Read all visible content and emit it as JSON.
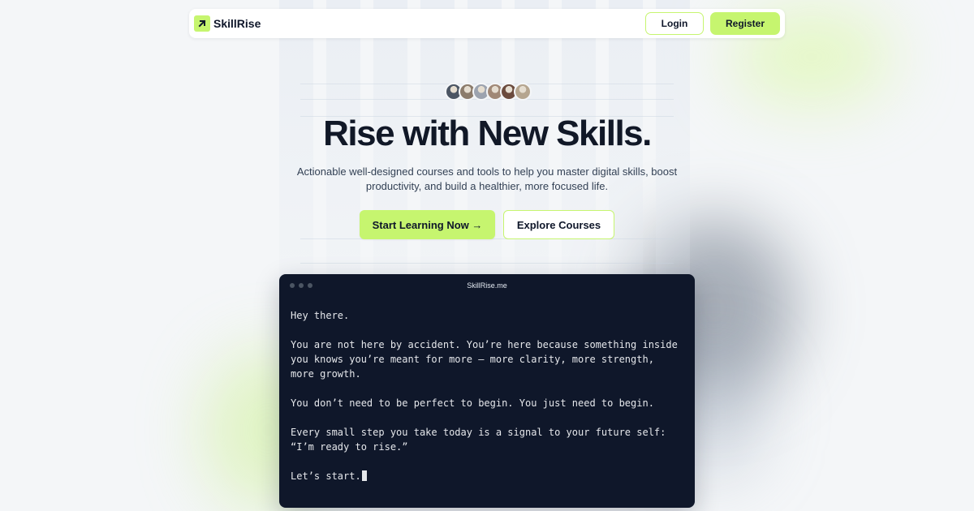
{
  "nav": {
    "brand": "SkillRise",
    "login_label": "Login",
    "register_label": "Register"
  },
  "hero": {
    "avatar_colors": [
      "#4b5563",
      "#8b7b6b",
      "#9ca3af",
      "#a08876",
      "#6b4b3e",
      "#b5a58f"
    ],
    "title": "Rise with New Skills.",
    "subtitle_line1": "Actionable well-designed courses and tools to help you master digital skills, boost",
    "subtitle_line2": "productivity, and build a healthier, more focused life.",
    "primary_cta": "Start Learning Now →",
    "secondary_cta": "Explore Courses"
  },
  "terminal": {
    "title": "SkillRise.me",
    "lines": {
      "l1": "Hey there.",
      "l2": "You are not here by accident. You’re here because something inside you knows you’re meant for more — more clarity, more strength, more growth.",
      "l3": "You don’t need to be perfect to begin. You just need to begin.",
      "l4": "Every small step you take today is a signal to your future self: “I’m ready to rise.”",
      "l5": "Let’s start."
    }
  },
  "colors": {
    "accent": "#c6f56f",
    "terminal_bg": "#0f172a",
    "page_bg": "#f4f6f8"
  }
}
